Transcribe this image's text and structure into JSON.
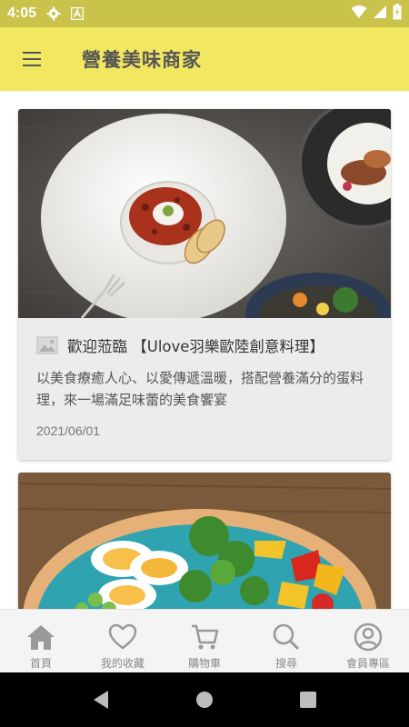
{
  "status_bar": {
    "time": "4:05",
    "left_icons": [
      "gear-icon",
      "font-a-icon"
    ],
    "right_icons": [
      "wifi-icon",
      "signal-icon",
      "battery-charging-icon"
    ]
  },
  "app_bar": {
    "title": "營養美味商家",
    "menu_icon": "hamburger-menu-icon"
  },
  "cards": [
    {
      "title": "歡迎蒞臨 【Ulove羽樂歐陸創意料理】",
      "description": "以美食療癒人心、以愛傳遞溫暖，搭配營養滿分的蛋料理，來一場滿足味蕾的美食饗宴",
      "date": "2021/06/01",
      "title_icon": "image-icon"
    },
    {
      "title": "",
      "description": "",
      "date": ""
    }
  ],
  "bottom_nav": {
    "items": [
      {
        "label": "首頁",
        "icon": "home-icon"
      },
      {
        "label": "我的收藏",
        "icon": "heart-icon"
      },
      {
        "label": "購物車",
        "icon": "cart-icon"
      },
      {
        "label": "搜尋",
        "icon": "search-icon"
      },
      {
        "label": "會員專區",
        "icon": "account-icon"
      }
    ]
  },
  "colors": {
    "status_bar": "#c9c24b",
    "app_bar": "#f2e761",
    "card_background": "#ececec",
    "nav_icon": "#9a9a9a"
  }
}
